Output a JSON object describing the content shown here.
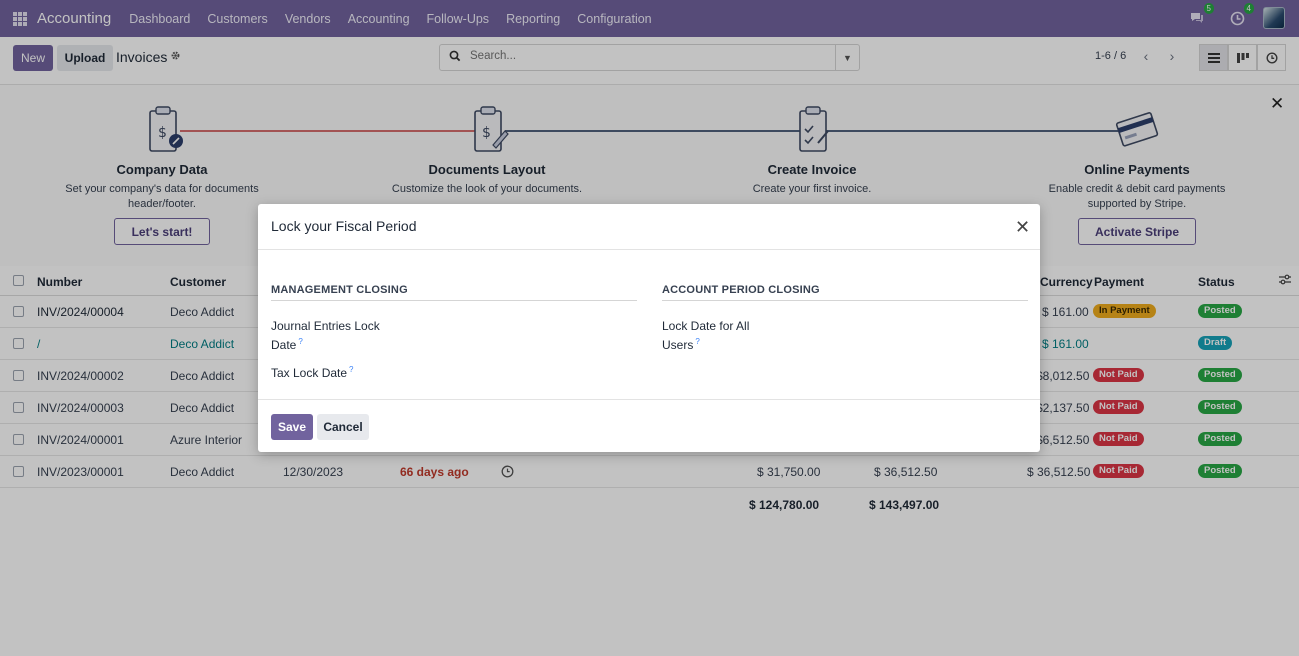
{
  "navbar": {
    "app_name": "Accounting",
    "menu": [
      "Dashboard",
      "Customers",
      "Vendors",
      "Accounting",
      "Follow-Ups",
      "Reporting",
      "Configuration"
    ],
    "messages_count": "5",
    "activities_count": "4",
    "bg_color": "#71639e"
  },
  "control": {
    "new_label": "New",
    "upload_label": "Upload",
    "title": "Invoices",
    "search_placeholder": "Search...",
    "pager": "1-6 / 6"
  },
  "onboarding": {
    "steps": [
      {
        "title": "Company Data",
        "desc": "Set your company's data for documents header/footer.",
        "button": "Let's start!"
      },
      {
        "title": "Documents Layout",
        "desc": "Customize the look of your documents.",
        "button": ""
      },
      {
        "title": "Create Invoice",
        "desc": "Create your first invoice.",
        "button": ""
      },
      {
        "title": "Online Payments",
        "desc": "Enable credit & debit card payments supported by Stripe.",
        "button": "Activate Stripe"
      }
    ]
  },
  "table": {
    "headers": {
      "number": "Number",
      "customer": "Customer",
      "currency": "Currency",
      "payment": "Payment",
      "status": "Status"
    },
    "rows": [
      {
        "number": "INV/2024/00004",
        "customer": "Deco Addict",
        "date": "",
        "due": "",
        "untaxed": "",
        "total": "",
        "currency": "$ 161.00",
        "payment": "In Payment",
        "status": "Posted"
      },
      {
        "number": "/",
        "customer": "Deco Addict",
        "date": "",
        "due": "",
        "untaxed": "",
        "total": "",
        "currency": "$ 161.00",
        "payment": "",
        "status": "Draft"
      },
      {
        "number": "INV/2024/00002",
        "customer": "Deco Addict",
        "date": "",
        "due": "",
        "untaxed": "",
        "total": "",
        "currency": "$8,012.50",
        "payment": "Not Paid",
        "status": "Posted"
      },
      {
        "number": "INV/2024/00003",
        "customer": "Deco Addict",
        "date": "",
        "due": "",
        "untaxed": "",
        "total": "",
        "currency": "$2,137.50",
        "payment": "Not Paid",
        "status": "Posted"
      },
      {
        "number": "INV/2024/00001",
        "customer": "Azure Interior",
        "date": "",
        "due": "",
        "untaxed": "",
        "total": "",
        "currency": "$6,512.50",
        "payment": "Not Paid",
        "status": "Posted"
      },
      {
        "number": "INV/2023/00001",
        "customer": "Deco Addict",
        "date": "12/30/2023",
        "due": "66 days ago",
        "untaxed": "$ 31,750.00",
        "total": "$ 36,512.50",
        "currency": "$ 36,512.50",
        "payment": "Not Paid",
        "status": "Posted"
      }
    ],
    "totals": {
      "untaxed": "$ 124,780.00",
      "total": "$ 143,497.00"
    }
  },
  "modal": {
    "title": "Lock your Fiscal Period",
    "management": {
      "title": "MANAGEMENT CLOSING",
      "journal_label_1": "Journal Entries Lock",
      "journal_label_2": "Date",
      "tax_label": "Tax Lock Date"
    },
    "account": {
      "title": "ACCOUNT PERIOD CLOSING",
      "lock_label_1": "Lock Date for All",
      "lock_label_2": "Users"
    },
    "help_mark": "?",
    "save_label": "Save",
    "cancel_label": "Cancel"
  }
}
